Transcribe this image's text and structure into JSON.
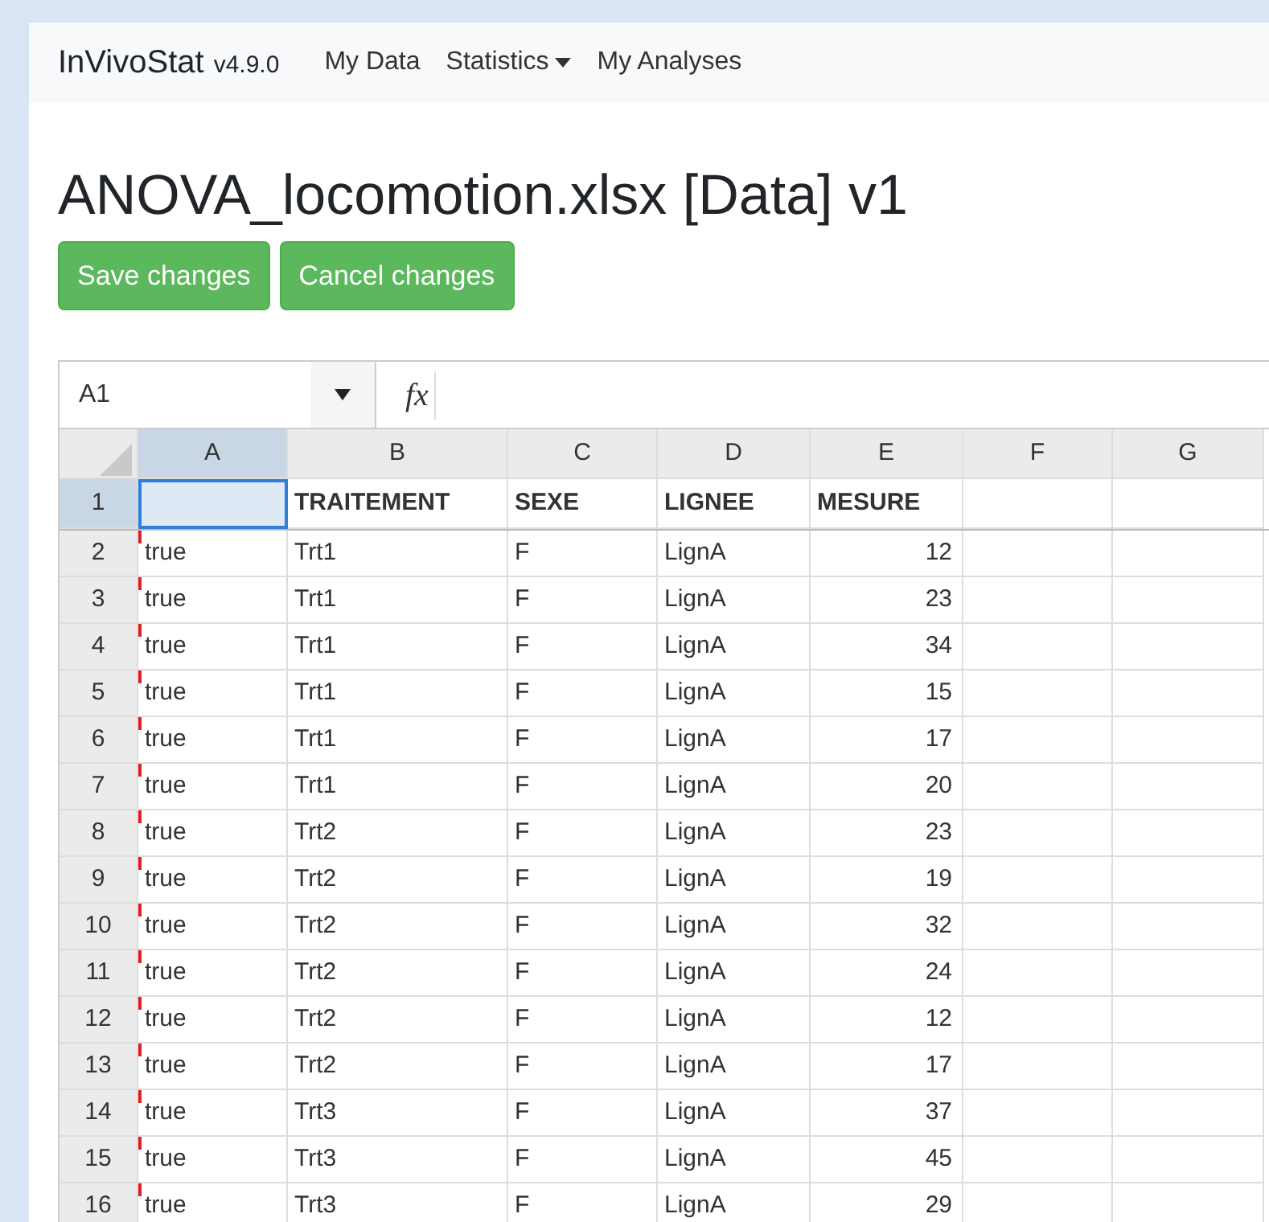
{
  "navbar": {
    "brand": "InVivoStat",
    "version": "v4.9.0",
    "links": [
      {
        "label": "My Data",
        "dropdown": false
      },
      {
        "label": "Statistics",
        "dropdown": true
      },
      {
        "label": "My Analyses",
        "dropdown": false
      }
    ]
  },
  "title": "ANOVA_locomotion.xlsx [Data] v1",
  "buttons": [
    "Save changes",
    "Cancel changes"
  ],
  "spreadsheet": {
    "name_box": "A1",
    "formula_icon": "fx",
    "columns": [
      {
        "label": "A",
        "selected": true
      },
      {
        "label": "B",
        "selected": false
      },
      {
        "label": "C",
        "selected": false
      },
      {
        "label": "D",
        "selected": false
      },
      {
        "label": "E",
        "selected": false
      },
      {
        "label": "F",
        "selected": false
      },
      {
        "label": "G",
        "selected": false
      }
    ],
    "header_row": {
      "number": "1",
      "selected": true,
      "cells": [
        "TRAITEMENT",
        "SEXE",
        "LIGNEE",
        "MESURE"
      ]
    },
    "rows": [
      {
        "number": "2",
        "flagged": true,
        "cells": [
          "true",
          "Trt1",
          "F",
          "LignA",
          "12"
        ]
      },
      {
        "number": "3",
        "flagged": true,
        "cells": [
          "true",
          "Trt1",
          "F",
          "LignA",
          "23"
        ]
      },
      {
        "number": "4",
        "flagged": true,
        "cells": [
          "true",
          "Trt1",
          "F",
          "LignA",
          "34"
        ]
      },
      {
        "number": "5",
        "flagged": true,
        "cells": [
          "true",
          "Trt1",
          "F",
          "LignA",
          "15"
        ]
      },
      {
        "number": "6",
        "flagged": true,
        "cells": [
          "true",
          "Trt1",
          "F",
          "LignA",
          "17"
        ]
      },
      {
        "number": "7",
        "flagged": true,
        "cells": [
          "true",
          "Trt1",
          "F",
          "LignA",
          "20"
        ]
      },
      {
        "number": "8",
        "flagged": true,
        "cells": [
          "true",
          "Trt2",
          "F",
          "LignA",
          "23"
        ]
      },
      {
        "number": "9",
        "flagged": true,
        "cells": [
          "true",
          "Trt2",
          "F",
          "LignA",
          "19"
        ]
      },
      {
        "number": "10",
        "flagged": true,
        "cells": [
          "true",
          "Trt2",
          "F",
          "LignA",
          "32"
        ]
      },
      {
        "number": "11",
        "flagged": true,
        "cells": [
          "true",
          "Trt2",
          "F",
          "LignA",
          "24"
        ]
      },
      {
        "number": "12",
        "flagged": true,
        "cells": [
          "true",
          "Trt2",
          "F",
          "LignA",
          "12"
        ]
      },
      {
        "number": "13",
        "flagged": true,
        "cells": [
          "true",
          "Trt2",
          "F",
          "LignA",
          "17"
        ]
      },
      {
        "number": "14",
        "flagged": true,
        "cells": [
          "true",
          "Trt3",
          "F",
          "LignA",
          "37"
        ]
      },
      {
        "number": "15",
        "flagged": true,
        "cells": [
          "true",
          "Trt3",
          "F",
          "LignA",
          "45"
        ]
      },
      {
        "number": "16",
        "flagged": true,
        "cells": [
          "true",
          "Trt3",
          "F",
          "LignA",
          "29"
        ]
      }
    ]
  }
}
